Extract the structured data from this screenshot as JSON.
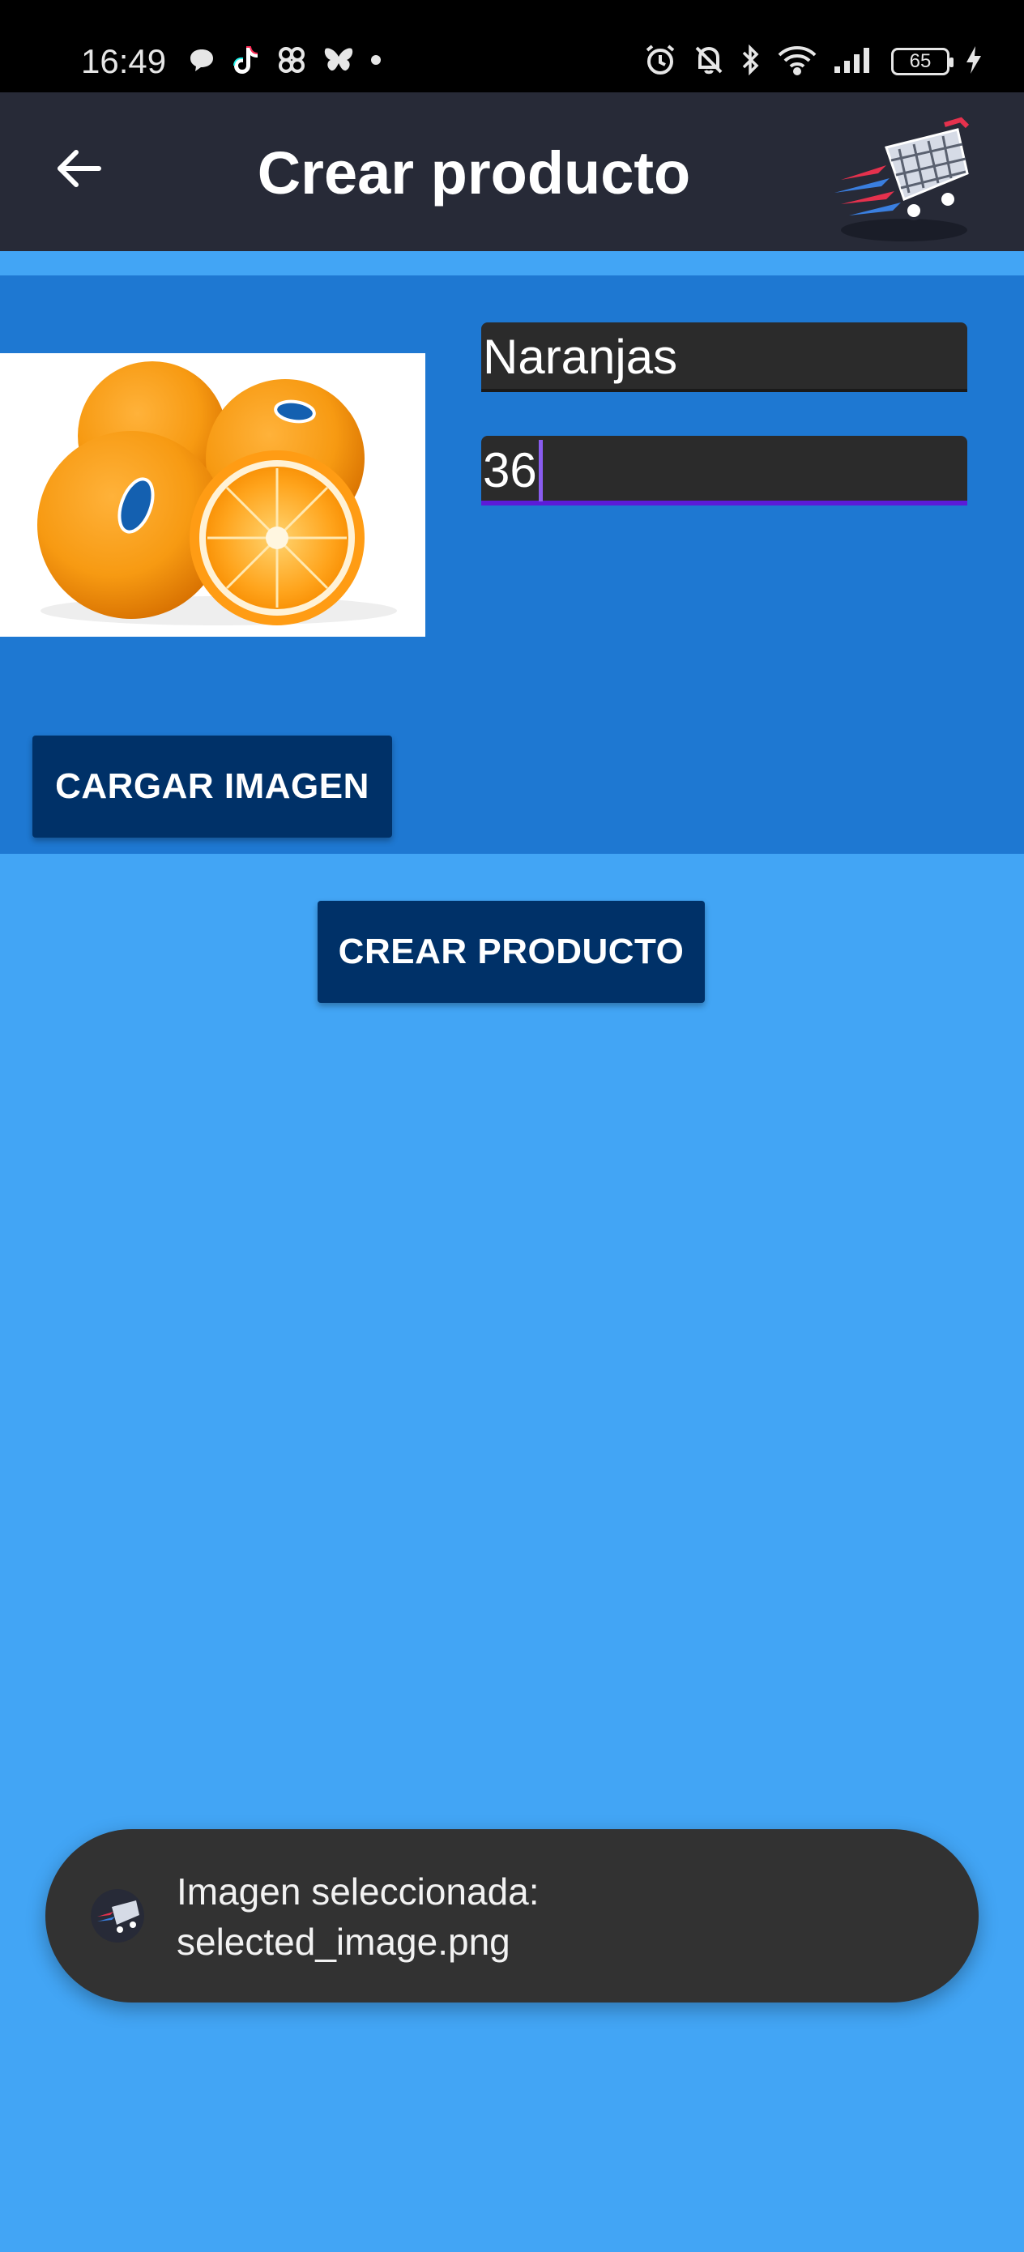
{
  "status_bar": {
    "time": "16:49",
    "battery": "65",
    "icons_left": [
      "chat-bubble-icon",
      "tiktok-icon",
      "pinwheel-icon",
      "butterfly-icon",
      "dot-icon"
    ],
    "icons_right": [
      "alarm-icon",
      "bell-muted-icon",
      "bluetooth-icon",
      "wifi-icon",
      "signal-icon",
      "battery-icon",
      "charging-icon"
    ]
  },
  "app_bar": {
    "title": "Crear producto",
    "back_icon": "arrow-back-icon",
    "logo_icon": "shopping-cart-logo-icon"
  },
  "form": {
    "name_value": "Naranjas",
    "price_value": "36",
    "image_description_icon": "oranges-image"
  },
  "buttons": {
    "load_image": "CARGAR IMAGEN",
    "create_product": "CREAR PRODUCTO"
  },
  "toast": {
    "line1": "Imagen seleccionada:",
    "line2": "selected_image.png"
  },
  "colors": {
    "background": "#42a5f5",
    "app_bar": "#272a37",
    "panel": "#1e78d2",
    "button": "#003168",
    "input": "#2b2b2b",
    "focus_underline": "#5b1bd8",
    "toast": "#323232"
  }
}
